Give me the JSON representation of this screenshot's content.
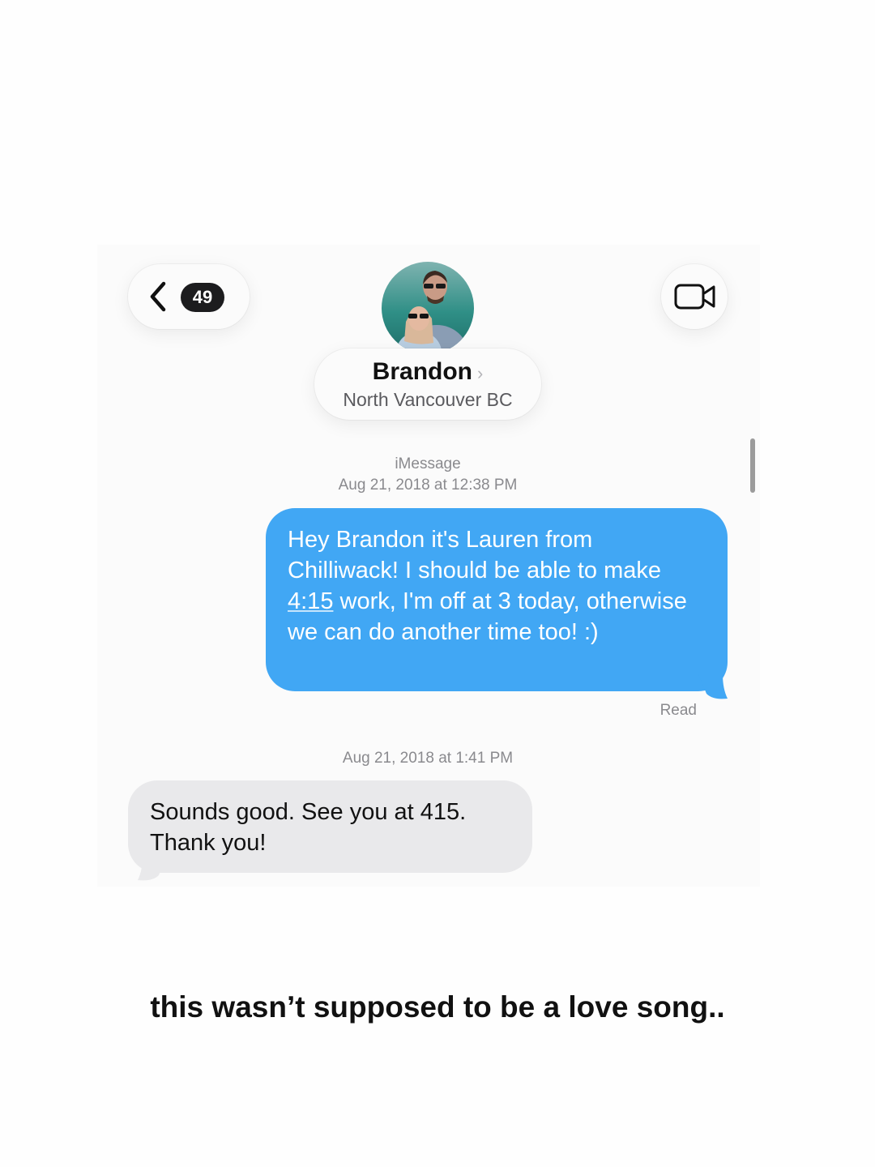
{
  "header": {
    "back_badge_count": "49",
    "contact_name": "Brandon",
    "contact_chevron": "›",
    "contact_subtitle": "North Vancouver BC",
    "icons": {
      "back": "chevron-left-icon",
      "video": "video-camera-icon"
    }
  },
  "thread": {
    "service_label": "iMessage",
    "first_timestamp": "Aug 21, 2018 at 12:38 PM",
    "outgoing": {
      "text_before": "Hey Brandon it's Lauren from Chilliwack! I should be able to make ",
      "text_link": "4:15",
      "text_after": " work, I'm off at 3 today, otherwise we can do another time too! :)"
    },
    "read_receipt": "Read",
    "second_timestamp": "Aug 21, 2018 at 1:41 PM",
    "incoming": {
      "text": "Sounds good. See you at 415. Thank you!"
    }
  },
  "caption": "this wasn’t supposed to be a love song..",
  "colors": {
    "outgoing_bubble": "#41a7f4",
    "incoming_bubble": "#e9e9eb",
    "badge": "#1c1c1e",
    "meta_text": "#8a8a8e"
  }
}
